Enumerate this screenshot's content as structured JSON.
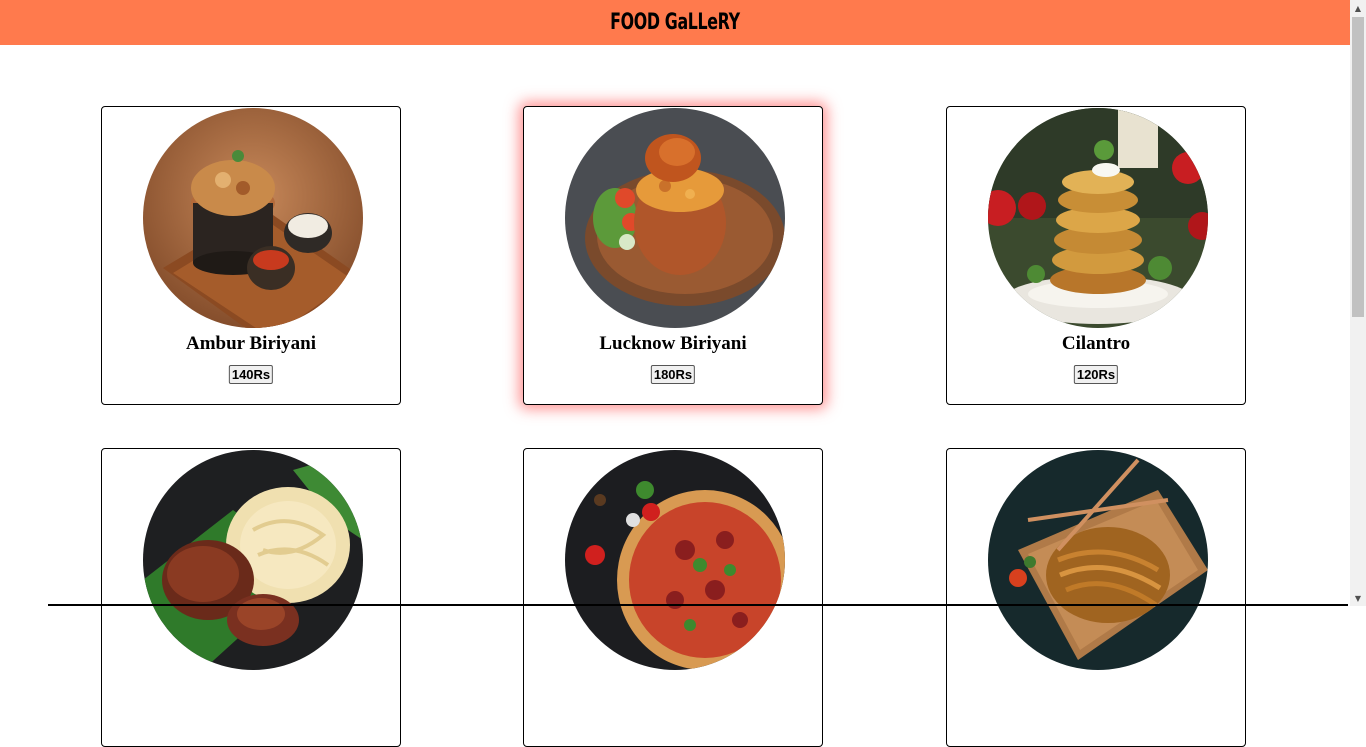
{
  "header": {
    "title": "FOOD GaLLeRY",
    "color": "#ff7a4d"
  },
  "items": [
    {
      "name": "Ambur Biriyani",
      "price": "140Rs",
      "icon": "biryani-bowl-image"
    },
    {
      "name": "Lucknow Biriyani",
      "price": "180Rs",
      "icon": "clay-pot-biryani-image"
    },
    {
      "name": "Cilantro",
      "price": "120Rs",
      "icon": "hash-brown-stack-image"
    },
    {
      "name": "",
      "price": "",
      "icon": "tandoori-chicken-parotta-image"
    },
    {
      "name": "",
      "price": "",
      "icon": "pizza-image"
    },
    {
      "name": "",
      "price": "",
      "icon": "noodles-image"
    }
  ],
  "colors": {
    "glow": "#ff3c3c",
    "card_border": "#000000"
  }
}
